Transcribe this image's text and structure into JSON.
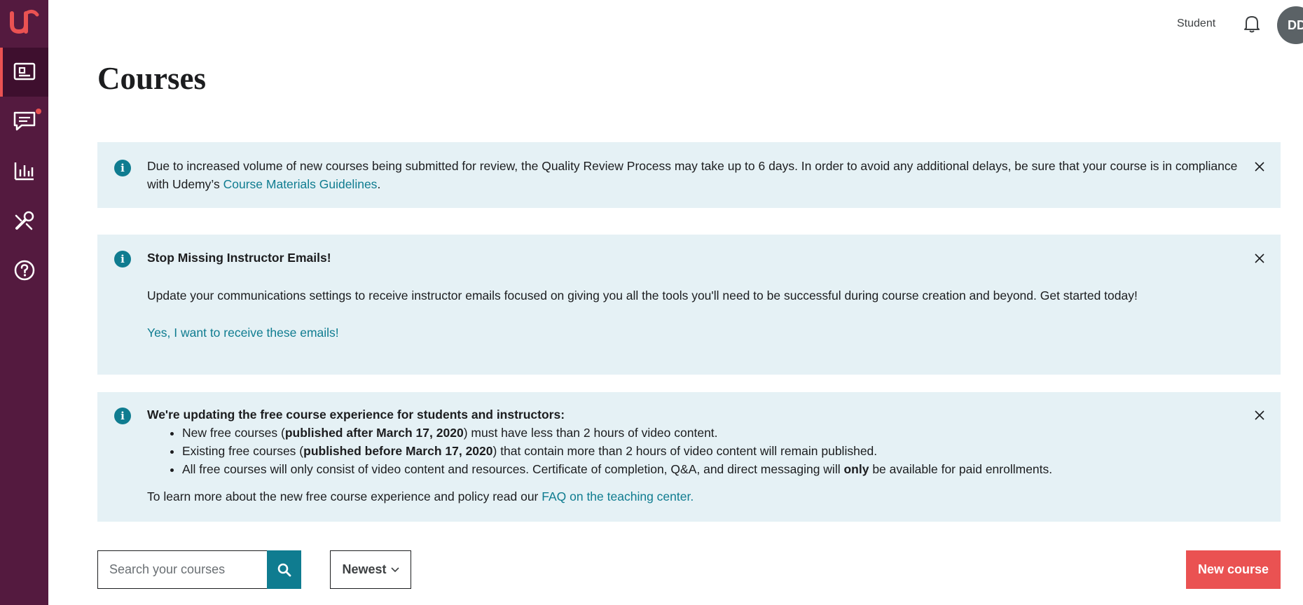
{
  "header": {
    "student_link": "Student",
    "avatar_initials": "DD",
    "page_title": "Courses"
  },
  "sidebar": {
    "items": [
      {
        "name": "courses",
        "icon": "video-course-icon",
        "active": true
      },
      {
        "name": "communication",
        "icon": "message-icon",
        "has_badge": true
      },
      {
        "name": "performance",
        "icon": "bar-chart-icon"
      },
      {
        "name": "tools",
        "icon": "tools-icon"
      },
      {
        "name": "resources",
        "icon": "help-icon"
      }
    ]
  },
  "alerts": {
    "review": {
      "text": "Due to increased volume of new courses being submitted for review, the Quality Review Process may take up to 6 days. In order to avoid any additional delays, be sure that your course is in compliance with Udemy’s ",
      "link": "Course Materials Guidelines",
      "tail": "."
    },
    "emails": {
      "title": "Stop Missing Instructor Emails!",
      "text": "Update your communications settings to receive instructor emails focused on giving you all the tools you'll need to be successful during course creation and beyond. Get started today!",
      "link": "Yes, I want to receive these emails!"
    },
    "free": {
      "title": "We're updating the free course experience for students and instructors:",
      "items": [
        {
          "pre": "New free courses (",
          "bold": "published after March 17, 2020",
          "post": ") must have less than 2 hours of video content."
        },
        {
          "pre": "Existing free courses (",
          "bold": "published before March 17, 2020",
          "post": ") that contain more than 2 hours of video content will remain published."
        },
        {
          "pre": "All free courses will only consist of video content and resources. Certificate of completion, Q&A, and direct messaging will ",
          "bold": "only",
          "post": " be available for paid enrollments."
        }
      ],
      "footer_text": "To learn more about the new free course experience and policy read our ",
      "footer_link": "FAQ on the teaching center."
    }
  },
  "controls": {
    "search_placeholder": "Search your courses",
    "sort_label": "Newest",
    "new_course_label": "New course"
  },
  "colors": {
    "sidebar": "#541a3f",
    "accent": "#ea5252",
    "teal": "#0f7c90",
    "alert_bg": "#e5f1f5"
  }
}
